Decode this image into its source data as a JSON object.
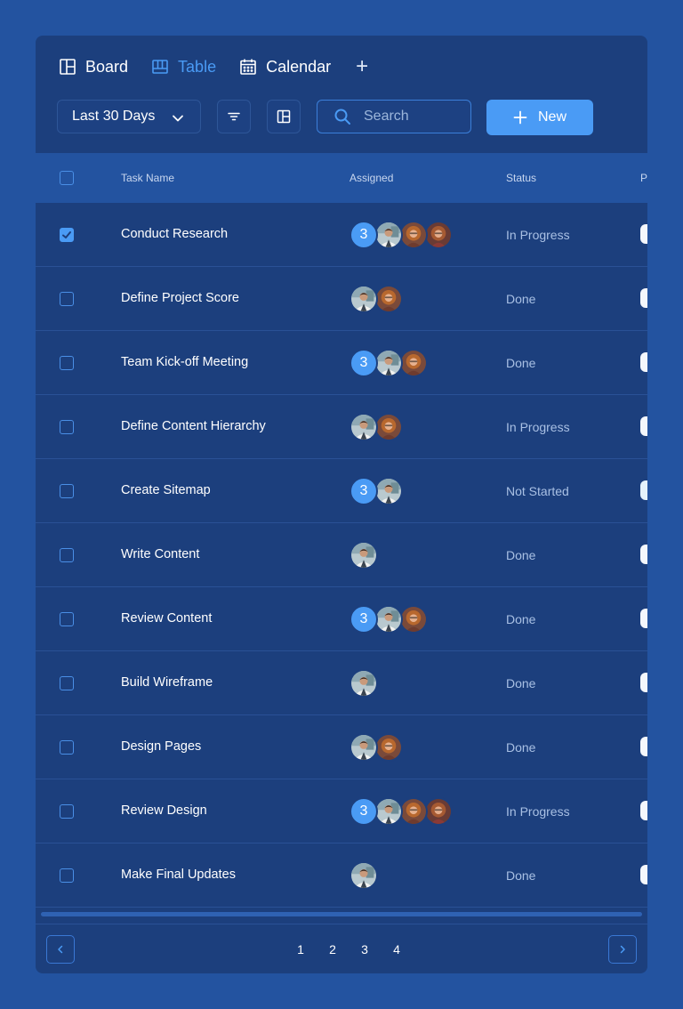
{
  "views": {
    "board_label": "Board",
    "table_label": "Table",
    "calendar_label": "Calendar",
    "add_label": "+"
  },
  "toolbar": {
    "date_range": "Last 30 Days",
    "search_placeholder": "Search",
    "new_label": "New"
  },
  "table": {
    "headers": {
      "task_name": "Task Name",
      "assigned": "Assigned",
      "status": "Status",
      "priority": "P"
    },
    "rows": [
      {
        "task": "Conduct Research",
        "count": "3",
        "avatars": [
          "man",
          "woman",
          "woman2"
        ],
        "status": "In Progress",
        "checked": true,
        "pill": "light"
      },
      {
        "task": "Define Project Score",
        "count": "",
        "avatars": [
          "man",
          "woman"
        ],
        "status": "Done",
        "checked": false,
        "pill": "light"
      },
      {
        "task": "Team Kick-off Meeting",
        "count": "3",
        "avatars": [
          "man",
          "woman"
        ],
        "status": "Done",
        "checked": false,
        "pill": "light"
      },
      {
        "task": "Define Content Hierarchy",
        "count": "",
        "avatars": [
          "man",
          "woman"
        ],
        "status": "In Progress",
        "checked": false,
        "pill": "light"
      },
      {
        "task": "Create Sitemap",
        "count": "3",
        "avatars": [
          "man"
        ],
        "status": "Not Started",
        "checked": false,
        "pill": "alt"
      },
      {
        "task": "Write Content",
        "count": "",
        "avatars": [
          "man"
        ],
        "status": "Done",
        "checked": false,
        "pill": "light"
      },
      {
        "task": "Review Content",
        "count": "3",
        "avatars": [
          "man",
          "woman"
        ],
        "status": "Done",
        "checked": false,
        "pill": "light"
      },
      {
        "task": "Build Wireframe",
        "count": "",
        "avatars": [
          "man"
        ],
        "status": "Done",
        "checked": false,
        "pill": "light"
      },
      {
        "task": "Design Pages",
        "count": "",
        "avatars": [
          "man",
          "woman"
        ],
        "status": "Done",
        "checked": false,
        "pill": "light"
      },
      {
        "task": "Review Design",
        "count": "3",
        "avatars": [
          "man",
          "woman",
          "woman2"
        ],
        "status": "In Progress",
        "checked": false,
        "pill": "light"
      },
      {
        "task": "Make Final Updates",
        "count": "",
        "avatars": [
          "man"
        ],
        "status": "Done",
        "checked": false,
        "pill": "light"
      }
    ]
  },
  "pagination": {
    "pages": [
      "1",
      "2",
      "3",
      "4"
    ]
  },
  "colors": {
    "background": "#2353a0",
    "panel": "#1c3f7d",
    "accent": "#4a9bf5",
    "status_text": "#a9c0e4"
  }
}
